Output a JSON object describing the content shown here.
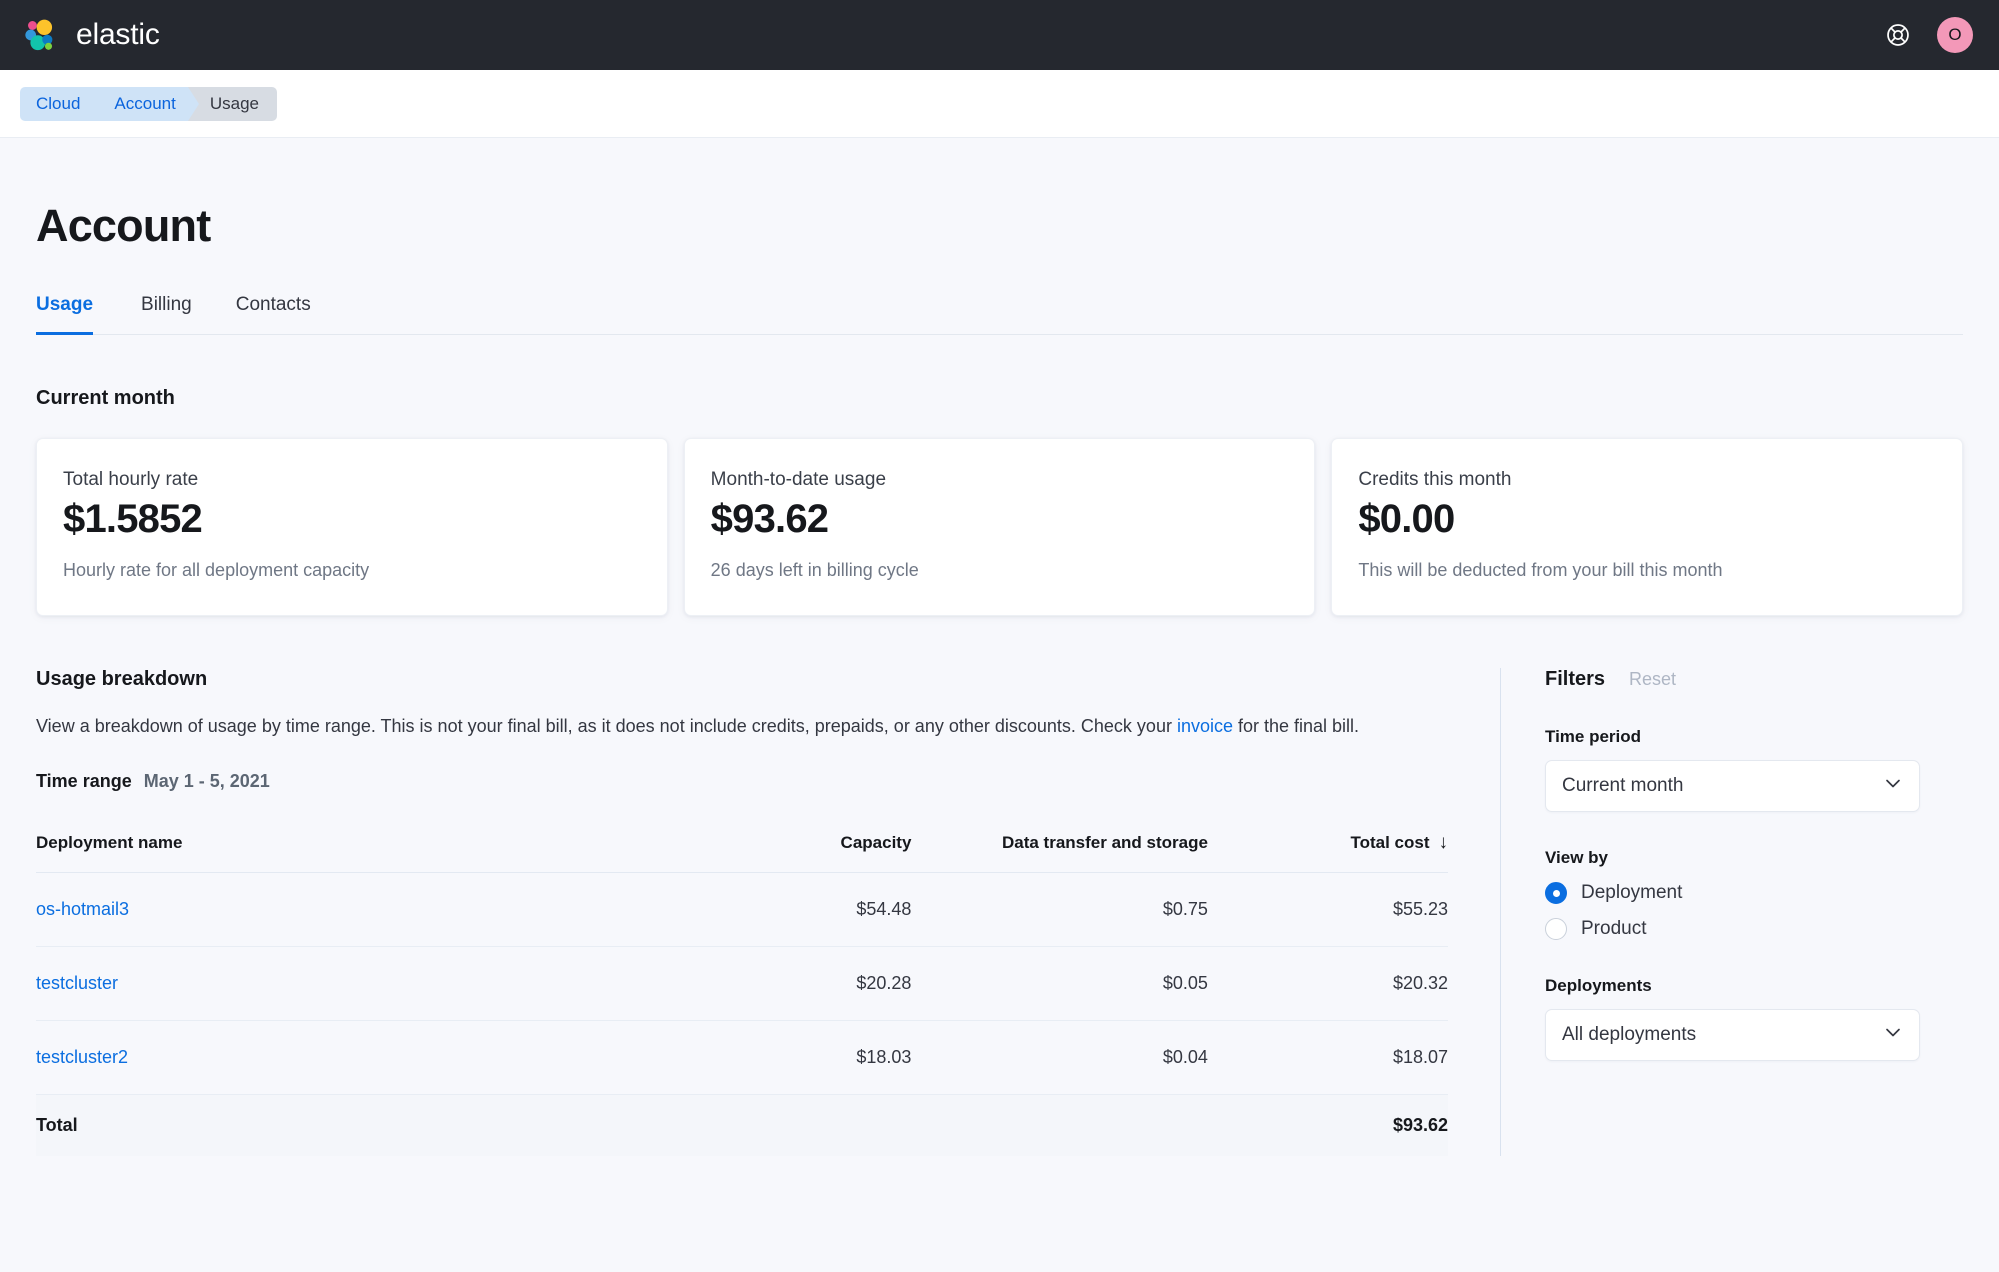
{
  "topbar": {
    "brand_name": "elastic",
    "logo_icon": "elastic-logo",
    "help_icon": "help-lifebuoy-icon",
    "avatar_initial": "O",
    "avatar_color": "#F398B8"
  },
  "breadcrumb": {
    "items": [
      {
        "label": "Cloud",
        "style": "blue"
      },
      {
        "label": "Account",
        "style": "blue"
      },
      {
        "label": "Usage",
        "style": "gray"
      }
    ]
  },
  "page": {
    "title": "Account"
  },
  "tabs": [
    {
      "label": "Usage",
      "active": true
    },
    {
      "label": "Billing",
      "active": false
    },
    {
      "label": "Contacts",
      "active": false
    }
  ],
  "current_month": {
    "heading": "Current month",
    "cards": [
      {
        "label": "Total hourly rate",
        "value": "$1.5852",
        "sub": "Hourly rate for all deployment capacity"
      },
      {
        "label": "Month-to-date usage",
        "value": "$93.62",
        "sub": "26 days left in billing cycle"
      },
      {
        "label": "Credits this month",
        "value": "$0.00",
        "sub": "This will be deducted from your bill this month"
      }
    ]
  },
  "breakdown": {
    "heading": "Usage breakdown",
    "description_before_link": "View a breakdown of usage by time range. This is not your final bill, as it does not include credits, prepaids, or any other discounts. Check your ",
    "link_text": "invoice",
    "description_after_link": " for the final bill.",
    "time_range_label": "Time range",
    "time_range_value": "May 1 - 5, 2021",
    "columns": {
      "name": "Deployment name",
      "capacity": "Capacity",
      "data_transfer": "Data transfer and storage",
      "total_cost": "Total cost",
      "sort_arrow": "↓"
    },
    "rows": [
      {
        "name": "os-hotmail3",
        "capacity": "$54.48",
        "data_transfer": "$0.75",
        "total": "$55.23"
      },
      {
        "name": "testcluster",
        "capacity": "$20.28",
        "data_transfer": "$0.05",
        "total": "$20.32"
      },
      {
        "name": "testcluster2",
        "capacity": "$18.03",
        "data_transfer": "$0.04",
        "total": "$18.07"
      }
    ],
    "total_row": {
      "label": "Total",
      "total": "$93.62"
    }
  },
  "filters": {
    "title": "Filters",
    "reset_label": "Reset",
    "time_period_label": "Time period",
    "time_period_value": "Current month",
    "view_by_label": "View by",
    "view_by_options": [
      {
        "label": "Deployment",
        "selected": true
      },
      {
        "label": "Product",
        "selected": false
      }
    ],
    "deployments_label": "Deployments",
    "deployments_value": "All deployments"
  },
  "colors": {
    "accent": "#0B6EE0",
    "topbar_bg": "#25282F",
    "page_bg": "#F7F8FC"
  }
}
